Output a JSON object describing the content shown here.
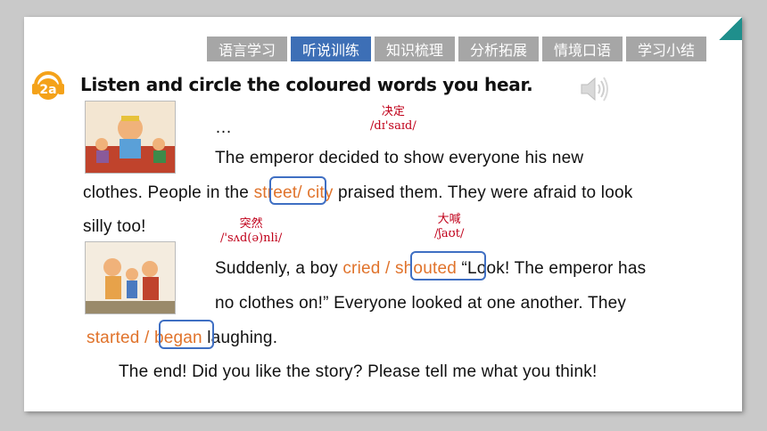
{
  "tabs": [
    {
      "label": "语言学习",
      "active": false
    },
    {
      "label": "听说训练",
      "active": true
    },
    {
      "label": "知识梳理",
      "active": false
    },
    {
      "label": "分析拓展",
      "active": false
    },
    {
      "label": "情境口语",
      "active": false
    },
    {
      "label": "学习小结",
      "active": false
    }
  ],
  "badge": "2a",
  "instruction": "Listen and circle the coloured words you hear.",
  "glosses": {
    "decided": {
      "cn": "决定",
      "ph": "/dɪ'saɪd/"
    },
    "suddenly": {
      "cn": "突然",
      "ph": "/'sʌd(ə)nli/"
    },
    "shouted": {
      "cn": "大喊",
      "ph": "/ʃaʊt/"
    }
  },
  "story": {
    "ellipsis": "…",
    "l1": "The emperor decided to show everyone his new",
    "l2_a": "clothes. People in the ",
    "l2_opt1": "street",
    "l2_slash": "/ ",
    "l2_opt2": "city",
    "l2_b": " praised them. They were afraid to look",
    "l3": "silly too!",
    "l4_a": "Suddenly, a boy ",
    "l4_opt1": "cried",
    "l4_slash": " / ",
    "l4_opt2": "shouted",
    "l4_b": "  “Look! The emperor has",
    "l5": "no clothes on!” Everyone looked at one another. They",
    "l6_opt1": "started",
    "l6_slash": " / ",
    "l6_opt2": "began",
    "l6_b": " laughing.",
    "l7": "The end! Did you like the story? Please tell me what you think!"
  },
  "colors": {
    "tab_active": "#3d6fb6",
    "tab_inactive": "#a6a6a6",
    "option": "#e0732b",
    "circle": "#3f6fc3",
    "gloss": "#c0001a"
  }
}
